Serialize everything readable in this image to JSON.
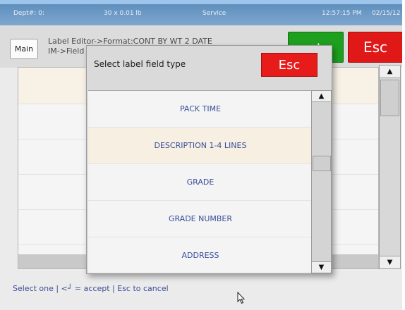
{
  "status_bar": {
    "dept": "Dept#: 0:",
    "weight": "30 x 0.01 lb",
    "mode": "Service",
    "time": "12:57:15 PM",
    "date": "02/15/12"
  },
  "header": {
    "main_label": "Main",
    "breadcrumb_line1": "Label Editor->Format:CONT BY WT 2 DATE",
    "breadcrumb_line2": "IM->Field",
    "accept_label": "↵",
    "esc_label": "Esc"
  },
  "dialog": {
    "title": "Select label field type",
    "esc_label": "Esc",
    "items": [
      {
        "label": "PACK TIME"
      },
      {
        "label": "DESCRIPTION 1-4 LINES",
        "selected": true
      },
      {
        "label": "GRADE"
      },
      {
        "label": "GRADE NUMBER"
      },
      {
        "label": "ADDRESS"
      }
    ]
  },
  "footer": {
    "prompt": "Select one | <┘ = accept | Esc to cancel"
  },
  "colors": {
    "status_bar": "#6f9bc8",
    "accept": "#1e9f1e",
    "esc": "#e01818",
    "selected_row": "#f6efe2",
    "item_text": "#3b4f9b"
  },
  "icons": {
    "scroll_up": "up-arrow-icon",
    "scroll_down": "down-arrow-icon",
    "pointer": "mouse-pointer-icon"
  }
}
